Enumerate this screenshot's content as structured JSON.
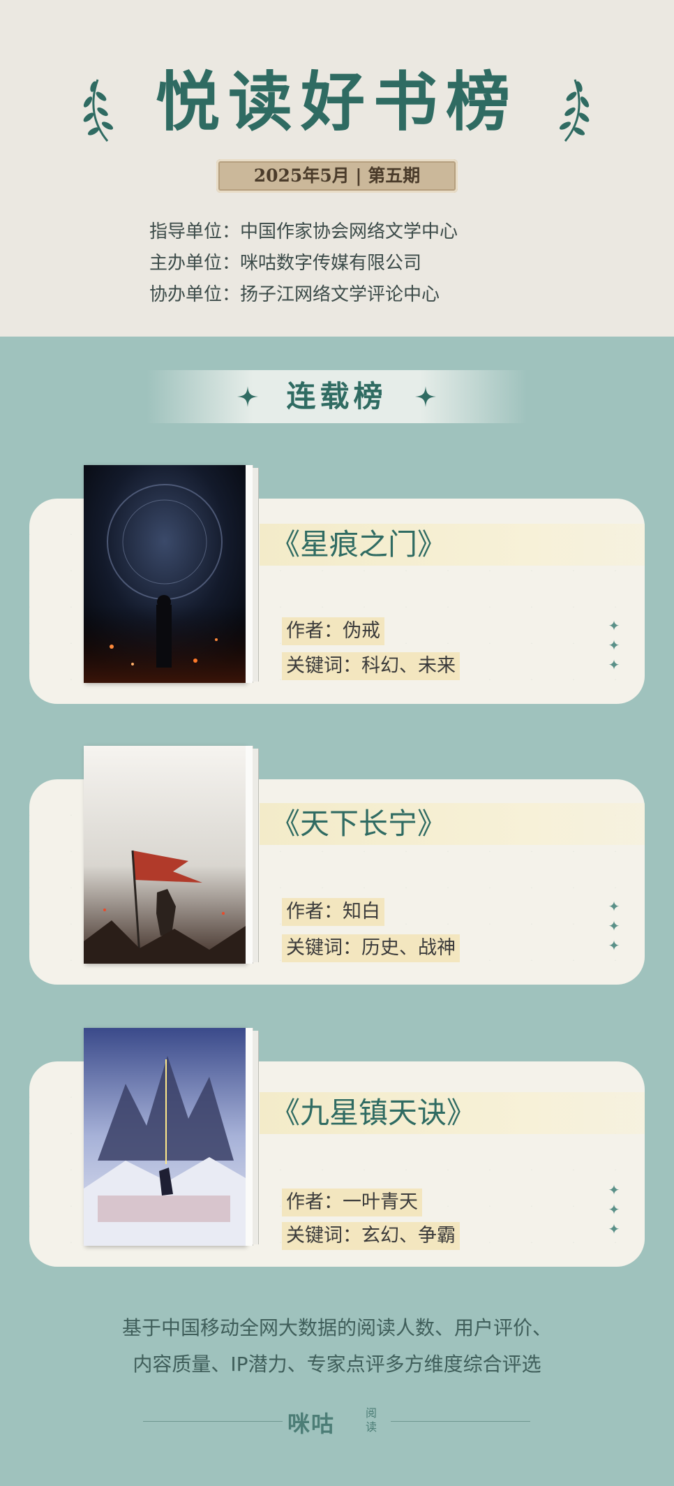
{
  "header": {
    "title": "悦读好书榜",
    "issue": "2025年5月 | 第五期",
    "orgs": [
      "指导单位：中国作家协会网络文学中心",
      "主办单位：咪咕数字传媒有限公司",
      "协办单位：扬子江网络文学评论中心"
    ]
  },
  "section": {
    "label": "连载榜"
  },
  "books": [
    {
      "title": "《星痕之门》",
      "author_line": "作者：伪戒",
      "keywords_line": "关键词：科幻、未来",
      "cover_title": "星痕之门"
    },
    {
      "title": "《天下长宁》",
      "author_line": "作者：知白",
      "keywords_line": "关键词：历史、战神",
      "cover_title": "天下长宁"
    },
    {
      "title": "《九星镇天诀》",
      "author_line": "作者：一叶青天",
      "keywords_line": "关键词：玄幻、争霸",
      "cover_title": "九星镇天诀"
    }
  ],
  "footer": {
    "note_lines": [
      "基于中国移动全网大数据的阅读人数、用户评价、",
      "内容质量、IP潜力、专家点评多方维度综合评选"
    ],
    "logo": "咪咕",
    "logo_sub": "阅读"
  },
  "colors": {
    "accent": "#2f6b62",
    "background": "#9fc2bd",
    "header_bg": "#ebe8e1",
    "highlight": "#f3e6bf"
  }
}
